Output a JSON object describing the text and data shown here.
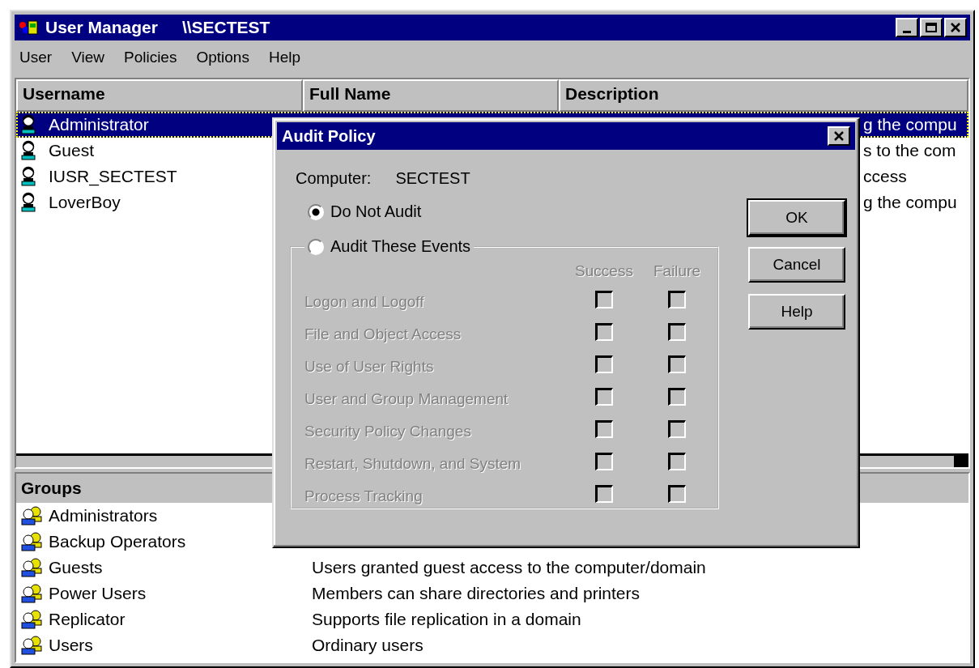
{
  "window": {
    "title": "User Manager",
    "server": "\\\\SECTEST"
  },
  "menu": [
    "User",
    "View",
    "Policies",
    "Options",
    "Help"
  ],
  "users": {
    "columns": [
      "Username",
      "Full Name",
      "Description"
    ],
    "rows": [
      {
        "username": "Administrator",
        "description": "g the compu",
        "selected": true
      },
      {
        "username": "Guest",
        "description": "s to the com",
        "selected": false
      },
      {
        "username": "IUSR_SECTEST",
        "description": "ccess",
        "selected": false
      },
      {
        "username": "LoverBoy",
        "description": "g the compu",
        "selected": false
      }
    ]
  },
  "groups": {
    "heading": "Groups",
    "rows": [
      {
        "name": "Administrators"
      },
      {
        "name": "Backup Operators"
      },
      {
        "name": "Guests",
        "description": "Users granted guest access to the computer/domain"
      },
      {
        "name": "Power Users",
        "description": "Members can share directories and printers"
      },
      {
        "name": "Replicator",
        "description": "Supports file replication in a domain"
      },
      {
        "name": "Users",
        "description": "Ordinary users"
      }
    ]
  },
  "dialog": {
    "title": "Audit Policy",
    "computer_label": "Computer:",
    "computer": "SECTEST",
    "options": [
      {
        "label": "Do Not Audit",
        "selected": true
      },
      {
        "label": "Audit These Events",
        "selected": false
      }
    ],
    "columns": [
      "Success",
      "Failure"
    ],
    "events": [
      {
        "label": "Logon and Logoff",
        "success": false,
        "failure": false,
        "disabled": true
      },
      {
        "label": "File and Object Access",
        "success": false,
        "failure": false,
        "disabled": true
      },
      {
        "label": "Use of User Rights",
        "success": false,
        "failure": false,
        "disabled": true
      },
      {
        "label": "User and Group Management",
        "success": false,
        "failure": false,
        "disabled": true
      },
      {
        "label": "Security Policy Changes",
        "success": false,
        "failure": false,
        "disabled": true
      },
      {
        "label": "Restart, Shutdown, and System",
        "success": false,
        "failure": false,
        "disabled": true
      },
      {
        "label": "Process Tracking",
        "success": false,
        "failure": false,
        "disabled": true
      }
    ],
    "buttons": [
      "OK",
      "Cancel",
      "Help"
    ]
  }
}
